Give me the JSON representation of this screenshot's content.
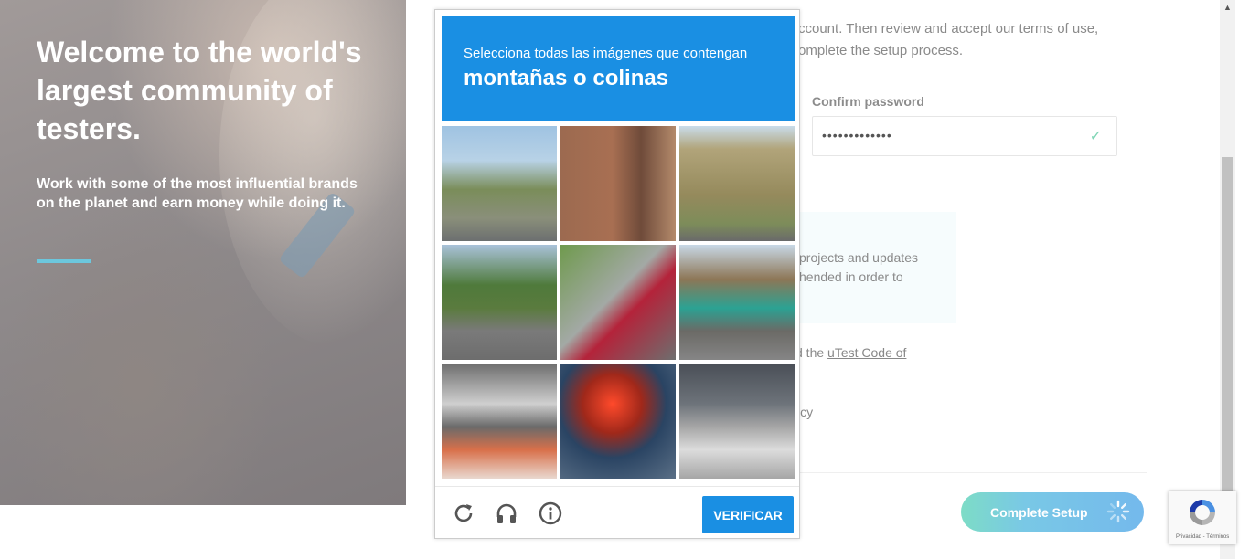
{
  "hero": {
    "title": "Welcome to the world's largest community of testers.",
    "subtitle": "Work with some of the most influential brands on the planet and earn money while doing it."
  },
  "form": {
    "intro_line1": "ccount. Then review and accept our terms of use,",
    "intro_line2": "omplete the setup process.",
    "confirm_password_label": "Confirm password",
    "confirm_password_value": "•••••••••••••",
    "info_line1": "projects and updates",
    "info_line2": "hended in order to",
    "code_prefix": "d the ",
    "code_link": "uTest Code of",
    "policy_text": "icy",
    "complete_button": "Complete Setup"
  },
  "captcha": {
    "instruction": "Selecciona todas las imágenes que contengan",
    "target": "montañas o colinas",
    "verify_button": "VERIFICAR",
    "tiles": [
      {
        "name": "coast-palms"
      },
      {
        "name": "brick-building"
      },
      {
        "name": "hillside-road"
      },
      {
        "name": "forest-road"
      },
      {
        "name": "red-car-street"
      },
      {
        "name": "bus-bridge"
      },
      {
        "name": "traffic-cones"
      },
      {
        "name": "traffic-light"
      },
      {
        "name": "crosswalk"
      }
    ]
  },
  "recaptcha_badge": {
    "terms": "Privacidad - Términos"
  },
  "colors": {
    "captcha_blue": "#1a8fe3",
    "accent_line": "#6cc7dd",
    "check_green": "#7fd5b5"
  },
  "icons": [
    "reload-icon",
    "headphones-icon",
    "info-icon",
    "check-icon",
    "spinner-icon",
    "recaptcha-logo-icon"
  ]
}
